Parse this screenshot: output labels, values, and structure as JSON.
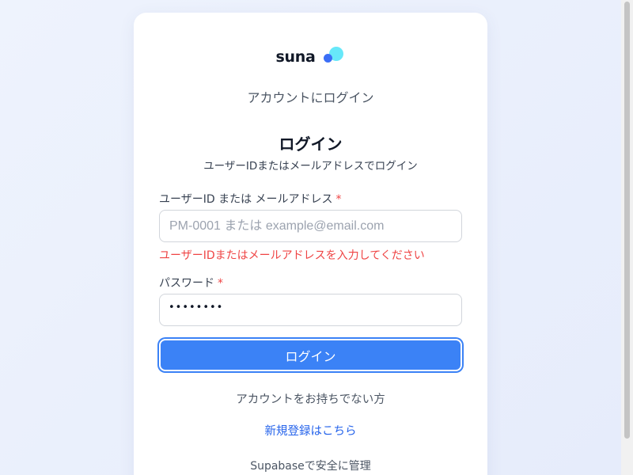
{
  "app": {
    "logo_text": "suna"
  },
  "card": {
    "subtitle": "アカウントにログイン",
    "heading": "ログイン",
    "heading_desc": "ユーザーIDまたはメールアドレスでログイン"
  },
  "form": {
    "user_id": {
      "label": "ユーザーID または メールアドレス",
      "required_mark": "*",
      "placeholder": "PM-0001 または example@email.com",
      "value": "",
      "error": "ユーザーIDまたはメールアドレスを入力してください"
    },
    "password": {
      "label": "パスワード",
      "required_mark": "*",
      "masked_value": "••••••••"
    },
    "submit_label": "ログイン"
  },
  "signup": {
    "prompt": "アカウントをお持ちでない方",
    "link_label": "新規登録はこちら"
  },
  "footer": {
    "text": "Supabaseで安全に管理"
  },
  "colors": {
    "accent": "#3b82f6",
    "error": "#ef4444",
    "link": "#2563eb",
    "logo_light": "#67e8f9",
    "logo_dark": "#3b6ef6"
  }
}
